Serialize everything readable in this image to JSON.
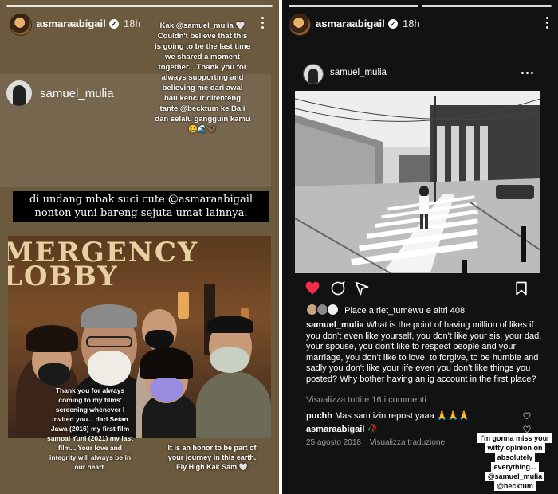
{
  "left_story": {
    "user": "asmaraabigail",
    "time": "18h",
    "caption": "Kak @samuel_mulia 🤍 Couldn't believe that this is going to be the last time we shared a moment together... Thank you for always supporting and believing me dari awal bau kencur ditenteng tante @becktum ke Bali dan selalu gangguin kamu 😆🌊🦋",
    "quoted_user": "samuel_mulia",
    "invite_text": "di undang mbak suci cute @asmaraabigail nonton yuni bareng sejuta umat lainnya.",
    "lobby_sign": "MERGENCY LOBBY",
    "photo_caption_1": "Thank you for always coming to my films' screening whenever I invited you... dari Setan Jawa (2016) my first film sampai Yuni (2021) my last film... Your love and integrity will always be in our heart.",
    "photo_caption_2": "It is an honor to be part of your journey in this earth. Fly High Kak Sam 🤍"
  },
  "right_story": {
    "user": "asmaraabigail",
    "time": "18h",
    "post_user": "samuel_mulia",
    "likes_text": "Piace a riet_tumewu e altri 408",
    "caption_user": "samuel_mulia",
    "caption_text": "What is the point of having million of likes if you don't even like yourself, you don't like your sis, your dad, your spouse, you don't like to respect people and your marriage, you don't like to love, to forgive, to be humble and sadly you don't like your life even you don't like things you posted? Why bother having  an ig account in the first place?",
    "view_comments": "Visualizza tutti e 16 i commenti",
    "comments": [
      {
        "user": "puchh",
        "text": "Mas sam izin repost yaaa 🙏🙏🙏"
      },
      {
        "user": "asmaraabigail",
        "text": "🥀"
      }
    ],
    "date": "25 agosto 2018",
    "translate": "Visualizza traduzione",
    "sticker_text": "I'm gonna miss your witty opinion on absolutely everything... @samuel_mulia @becktum"
  },
  "colors": {
    "left_bg": "#6b5a3e",
    "right_bg": "#121212",
    "like_red": "#ed2e44"
  }
}
